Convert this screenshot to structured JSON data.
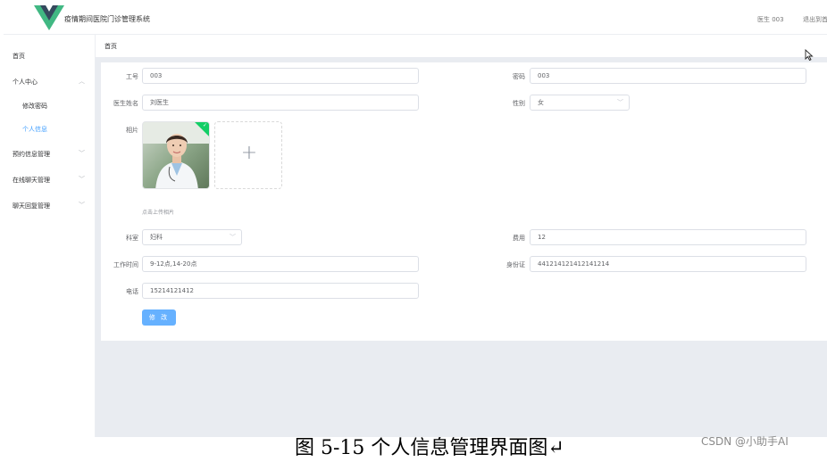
{
  "header": {
    "app_title": "疫情期间医院门诊管理系统",
    "user_name": "医生 003",
    "logout": "退出到首页"
  },
  "sidebar": {
    "items": [
      {
        "label": "首页"
      },
      {
        "label": "个人中心"
      },
      {
        "label": "修改密码"
      },
      {
        "label": "个人信息"
      },
      {
        "label": "预约信息管理"
      },
      {
        "label": "在线聊天管理"
      },
      {
        "label": "聊天回复管理"
      }
    ],
    "active_item": "个人信息"
  },
  "breadcrumb": {
    "current": "首页"
  },
  "form": {
    "employee_id": {
      "label": "工号",
      "value": "003"
    },
    "password": {
      "label": "密码",
      "value": "003"
    },
    "doctor_name": {
      "label": "医生姓名",
      "value": "刘医生"
    },
    "gender": {
      "label": "性别",
      "value": "女"
    },
    "photo": {
      "label": "相片",
      "upload_tip": "点击上传相片",
      "upload_icon": "plus-icon"
    },
    "department": {
      "label": "科室",
      "value": "妇科"
    },
    "fee": {
      "label": "费用",
      "value": "12"
    },
    "work_time": {
      "label": "工作时间",
      "value": "9-12点,14-20点"
    },
    "id_card": {
      "label": "身份证",
      "value": "441214121412141214"
    },
    "phone": {
      "label": "电话",
      "value": "15214121412"
    },
    "submit_label": "修 改"
  },
  "caption": "图 5-15 个人信息管理界面图↵",
  "watermark": "CSDN @小助手AI",
  "colors": {
    "accent": "#409eff",
    "button": "#66b1ff",
    "logo_green": "#41b883",
    "logo_dark": "#35495e",
    "success_badge": "#13ce66",
    "content_bg": "#e9ecf1"
  }
}
